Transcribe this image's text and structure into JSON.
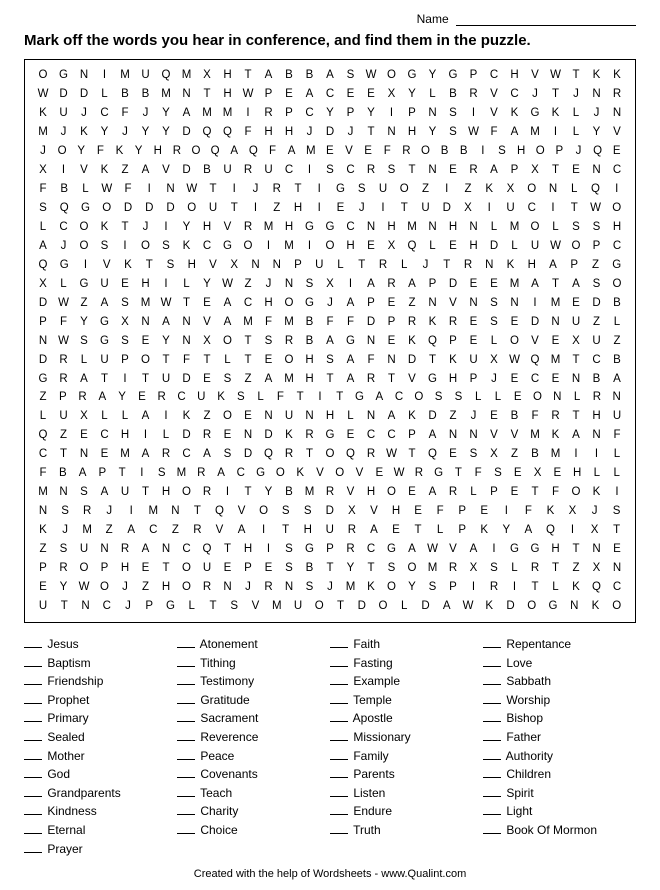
{
  "name_label": "Name",
  "title": "Mark off the words you hear in conference, and find them in the puzzle.",
  "grid": [
    "OGNIMUQMXHTABBASWOGYGPCHVWTKK",
    "WDDLBBMNTHWPEACEEXYLBRVCJTJNR",
    "KUJCFJYAMMIRPCYPYIPNSIVKGKLJN",
    "MJKYJYYDQQFHHJDJTNHYSWFAMILYV",
    "JOYFKYHROQAQFAMEVEFROBBISHOPJQE",
    "XIVKZAVDBURUCISCRSTNERAPXTENC",
    "FBLWFINWTIJRTIGSUOZIZKXONLQI",
    "SQGODDDOUTIZHIEJITUDXIUCITWO",
    "LCOKTJIYHVRMHGGCNHMNHNLMOLSSH",
    "AJOSIOSKCGOIMIOHEXQLEHDLUWOPC",
    "QGIVKTSHVXNNPULTRLJTRNKHAPZG",
    "XLGUEHILYWZJNSXIARAPDEEMATASO",
    "DWZASMWTEACHOGJAPEZNVNSNIMEDB",
    "PFYGXNANVAMFMBFFDPRKRESEDNUZL",
    "NWSGSEYNXOTSRBAGNEKQPELOVEXUZ",
    "DRLUPOTFTLTEOHSAFNDTKUXWQMTCB",
    "GRATITUDESZAMHTARTVGHPJECENBA",
    "ZPRAYERCUKSLFTITGACOSSLLEONLRN",
    "LUXLLAIKZOENUNHLNAKDZJEBFRTHU",
    "QZECHILDRENDKRGECCPANNVVMKANF",
    "CTNEMARCASDQRTOQRWTQESXZBMIIL",
    "FBAPTISMRACGOKVOVEWRGTFSEXEHLL",
    "MNSAUTHORITYBMRVHOEARLPETFOKI",
    "NSRJIMNTQVOSSDXVHEFPEIFKXJS",
    "KJMZACZRVAITHURAETLPKYAQIXT",
    "ZSUNRANCQTHISGPRCGAWVAIGGHTNE",
    "PROPHETOUEPESBTYTSOMRXSLRTZXN",
    "EYWOJZHORNJRNSJMKOYSPIRITLKQC",
    "UTNCJPGLTSVMUOTDOLDAWKDOGNKO"
  ],
  "word_columns": [
    [
      "Jesus",
      "Baptism",
      "Friendship",
      "Prophet",
      "Primary",
      "Sealed",
      "Mother",
      "God",
      "Grandparents",
      "Kindness",
      "Eternal",
      "Prayer"
    ],
    [
      "Atonement",
      "Tithing",
      "Testimony",
      "Gratitude",
      "Sacrament",
      "Reverence",
      "Peace",
      "Covenants",
      "Teach",
      "Charity",
      "Choice"
    ],
    [
      "Faith",
      "Fasting",
      "Example",
      "Temple",
      "Apostle",
      "Missionary",
      "Family",
      "Parents",
      "Listen",
      "Endure",
      "Truth"
    ],
    [
      "Repentance",
      "Love",
      "Sabbath",
      "Worship",
      "Bishop",
      "Father",
      "Authority",
      "Children",
      "Spirit",
      "Light",
      "Book Of Mormon"
    ]
  ],
  "footer": "Created with the help of Wordsheets - www.Qualint.com"
}
